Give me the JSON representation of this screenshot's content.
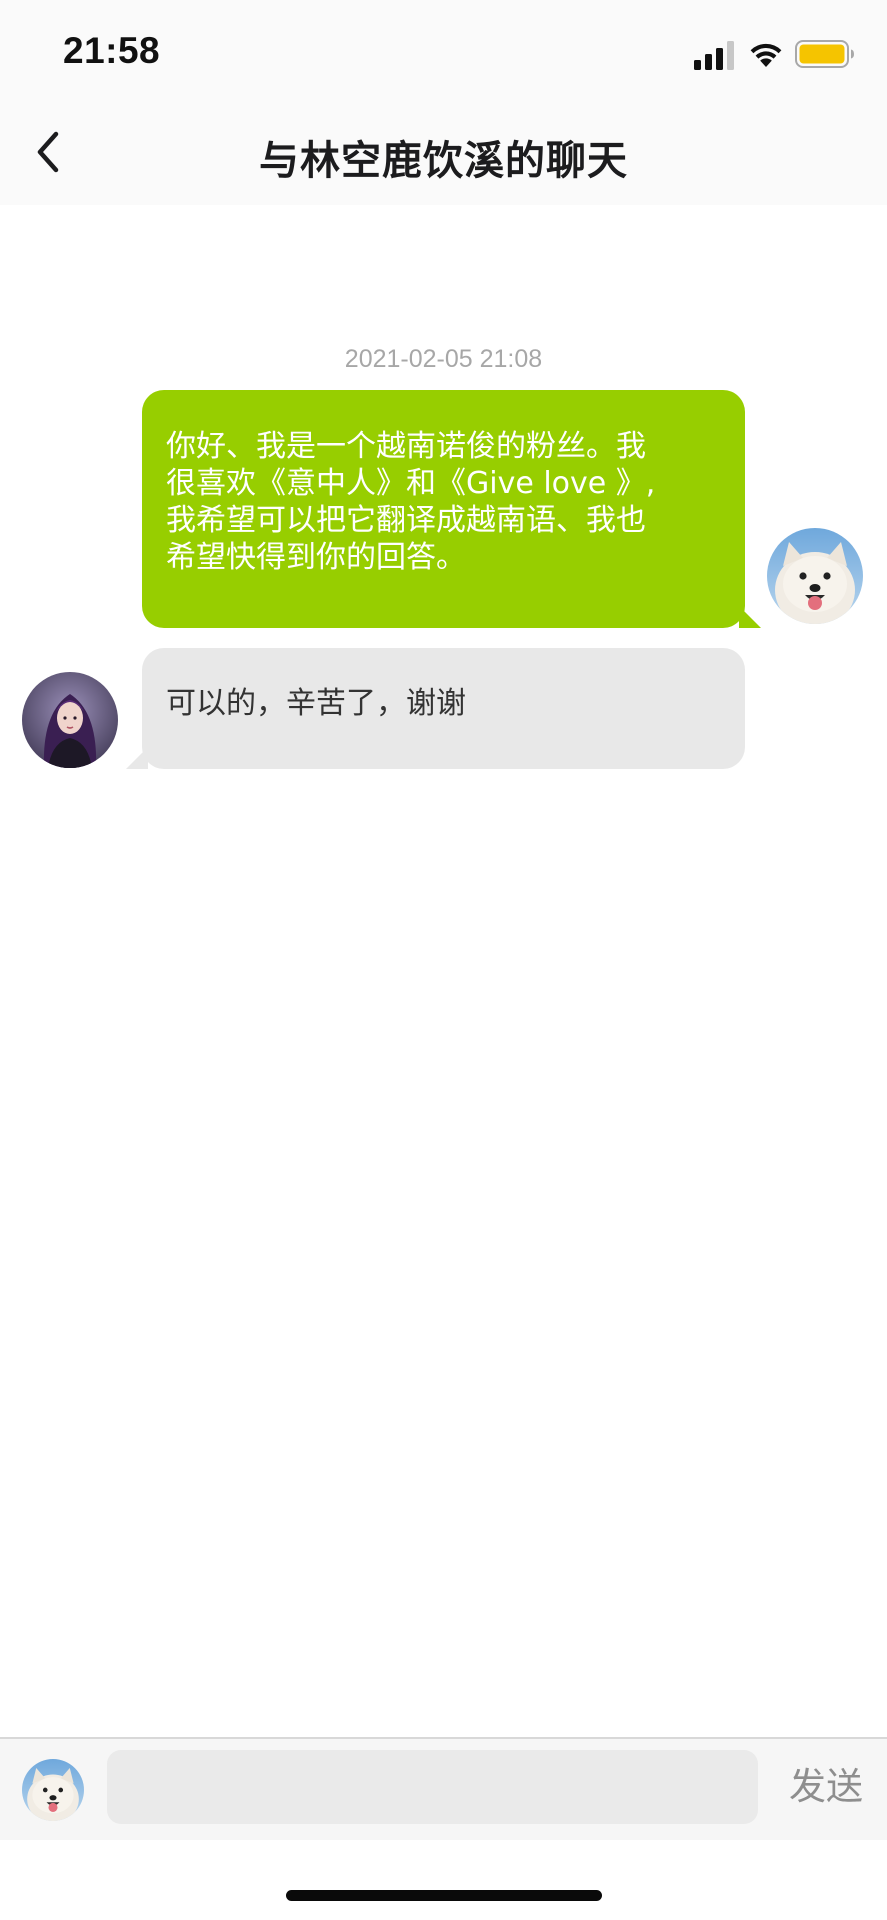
{
  "status_bar": {
    "time": "21:58",
    "icons": [
      "cellular-signal-icon",
      "wifi-icon",
      "battery-icon"
    ],
    "battery_color": "#f5c400"
  },
  "nav": {
    "back_icon": "chevron-left-icon",
    "title": "与林空鹿饮溪的聊天"
  },
  "chat": {
    "timestamp": "2021-02-05 21:08",
    "messages": [
      {
        "direction": "sent",
        "lines": [
          "你好、我是一个越南诺俊的粉丝。我",
          "很喜欢《意中人》和《Give love 》,",
          "我希望可以把它翻译成越南语、我也",
          "希望快得到你的回答。"
        ],
        "bubble_color": "#97ce00",
        "avatar": "samoyed-dog-avatar"
      },
      {
        "direction": "received",
        "text": "可以的，辛苦了，谢谢",
        "bubble_color": "#e8e8e8",
        "avatar": "purple-hair-girl-avatar"
      }
    ]
  },
  "input_bar": {
    "avatar": "samoyed-dog-avatar",
    "placeholder": "",
    "value": "",
    "send_label": "发送"
  }
}
